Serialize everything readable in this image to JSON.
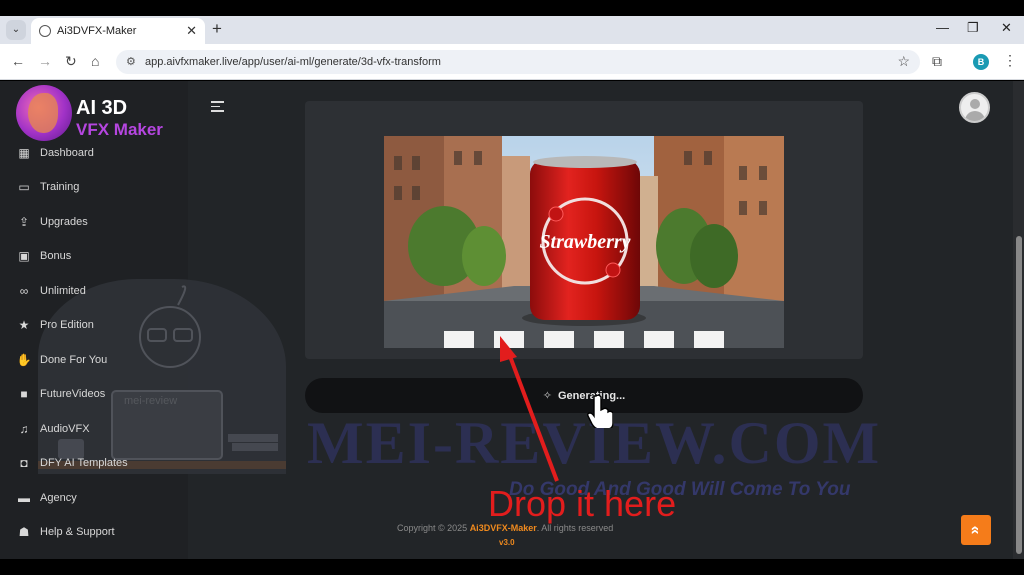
{
  "browser": {
    "tab_title": "Ai3DVFX-Maker",
    "url": "app.aivfxmaker.live/app/user/ai-ml/generate/3d-vfx-transform",
    "profile_initial": "B"
  },
  "brand": {
    "line1": "AI 3D",
    "line2": "VFX Maker"
  },
  "sidebar": {
    "items": [
      {
        "label": "Dashboard",
        "icon": "table-icon"
      },
      {
        "label": "Training",
        "icon": "monitor-icon"
      },
      {
        "label": "Upgrades",
        "icon": "upload-icon"
      },
      {
        "label": "Bonus",
        "icon": "gift-icon"
      },
      {
        "label": "Unlimited",
        "icon": "infinity-icon"
      },
      {
        "label": "Pro Edition",
        "icon": "star-icon"
      },
      {
        "label": "Done For You",
        "icon": "hand-icon"
      },
      {
        "label": "FutureVideos",
        "icon": "video-icon"
      },
      {
        "label": "AudioVFX",
        "icon": "music-icon"
      },
      {
        "label": "DFY AI Templates",
        "icon": "robot-icon"
      },
      {
        "label": "Agency",
        "icon": "briefcase-icon"
      },
      {
        "label": "Help & Support",
        "icon": "support-icon"
      }
    ]
  },
  "preview": {
    "product_text": "Strawberry"
  },
  "generate_button": {
    "label": "Generating..."
  },
  "watermark": {
    "main": "MEI-REVIEW.COM",
    "tagline": "Do Good And Good Will Come To You",
    "persona_label": "mei-review"
  },
  "annotation": {
    "text": "Drop it here",
    "color": "#e21d1d"
  },
  "footer": {
    "copyright_prefix": "Copyright © 2025 ",
    "brand": "Ai3DVFX-Maker",
    "copyright_suffix": ". All rights reserved",
    "version": "v3.0"
  },
  "colors": {
    "accent": "#f57c1a",
    "sidebar_bg": "#1f2124",
    "content_bg": "#222528"
  }
}
